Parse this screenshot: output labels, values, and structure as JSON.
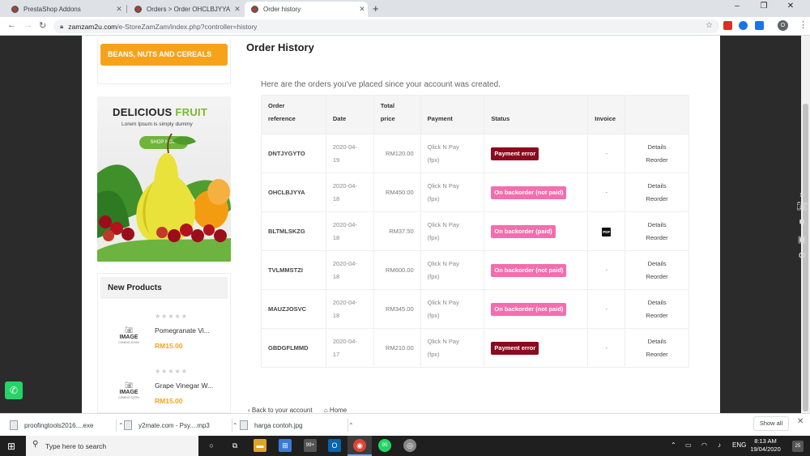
{
  "browser": {
    "tabs": [
      {
        "title": "PrestaShop Addons",
        "active": false
      },
      {
        "title": "Orders > Order OHCLBJYYA from",
        "active": false
      },
      {
        "title": "Order history",
        "active": true
      }
    ],
    "new_tab_symbol": "+",
    "window_controls": {
      "minimize": "–",
      "restore": "❐",
      "close": "✕"
    },
    "nav": {
      "back": "←",
      "forward": "→",
      "reload": "↻"
    },
    "url_host": "zamzam2u.com",
    "url_path": "/e-StoreZamZam/index.php?controller=history",
    "profile_initial": "O",
    "extension_colors": [
      "#d93025",
      "#1a73e8",
      "#1a73e8",
      "#0f9d58",
      "#4285f4"
    ]
  },
  "sidebar": {
    "category_button": "BEANS, NUTS AND CEREALS",
    "banner": {
      "title_word1": "DELICIOUS",
      "title_word2": "FRUIT",
      "subtitle": "Lorem Ipsum is simply dummy",
      "cta": "SHOP NOW"
    },
    "new_products_heading": "New Products",
    "placeholder": {
      "label": "IMAGE",
      "sublabel": "COMING SOON"
    },
    "products": [
      {
        "name": "Pomegranate Vi...",
        "price": "RM15.00",
        "rating_stars": 5,
        "rating_value": 0
      },
      {
        "name": "Grape Vinegar W...",
        "price": "RM15.00",
        "rating_stars": 5,
        "rating_value": 0
      }
    ]
  },
  "main": {
    "page_title": "Order History",
    "intro": "Here are the orders you've placed since your account was created.",
    "columns": {
      "reference": [
        "Order",
        "reference"
      ],
      "date": "Date",
      "total": [
        "Total",
        "price"
      ],
      "payment": "Payment",
      "status": "Status",
      "invoice": "Invoice"
    },
    "orders": [
      {
        "reference": "DNTJYGYTO",
        "date": [
          "2020-04-",
          "19"
        ],
        "total": "RM120.00",
        "payment": [
          "Qlick N Pay",
          "(fpx)"
        ],
        "status": "Payment error",
        "status_color": "#8b0a1f",
        "invoice": "-",
        "actions": [
          "Details",
          "Reorder"
        ]
      },
      {
        "reference": "OHCLBJYYA",
        "date": [
          "2020-04-",
          "18"
        ],
        "total": "RM450.00",
        "payment": [
          "Qlick N Pay",
          "(fpx)"
        ],
        "status": "On backorder (not paid)",
        "status_color": "#f56dac",
        "invoice": "-",
        "actions": [
          "Details",
          "Reorder"
        ]
      },
      {
        "reference": "BLTMLSKZG",
        "date": [
          "2020-04-",
          "18"
        ],
        "total": "RM37.50",
        "payment": [
          "Qlick N Pay",
          "(fpx)"
        ],
        "status": "On backorder (paid)",
        "status_color": "#f56dac",
        "invoice": "PDF",
        "actions": [
          "Details",
          "Reorder"
        ]
      },
      {
        "reference": "TVLMMSTZI",
        "date": [
          "2020-04-",
          "18"
        ],
        "total": "RM600.00",
        "payment": [
          "Qlick N Pay",
          "(fpx)"
        ],
        "status": "On backorder (not paid)",
        "status_color": "#f56dac",
        "invoice": "-",
        "actions": [
          "Details",
          "Reorder"
        ]
      },
      {
        "reference": "MAUZJOSVC",
        "date": [
          "2020-04-",
          "18"
        ],
        "total": "RM345.00",
        "payment": [
          "Qlick N Pay",
          "(fpx)"
        ],
        "status": "On backorder (not paid)",
        "status_color": "#f56dac",
        "invoice": "-",
        "actions": [
          "Details",
          "Reorder"
        ]
      },
      {
        "reference": "GBDGFLMMD",
        "date": [
          "2020-04-",
          "17"
        ],
        "total": "RM210.00",
        "payment": [
          "Qlick N Pay",
          "(fpx)"
        ],
        "status": "Payment error",
        "status_color": "#8b0a1f",
        "invoice": "-",
        "actions": [
          "Details",
          "Reorder"
        ]
      }
    ],
    "footer_links": [
      "‹ Back to your account",
      "⌂ Home"
    ]
  },
  "downloads": [
    {
      "name": "proofingtools2016....exe"
    },
    {
      "name": "y2mate.com - Psy....mp3"
    },
    {
      "name": "harga contoh.jpg"
    }
  ],
  "downloads_show_all": "Show all",
  "taskbar": {
    "search_placeholder": "Type here to search",
    "badges": {
      "store": "99+",
      "whatsapp": "90"
    },
    "language": "ENG",
    "time": "8:13 AM",
    "date": "19/04/2020",
    "notifications": "25"
  }
}
